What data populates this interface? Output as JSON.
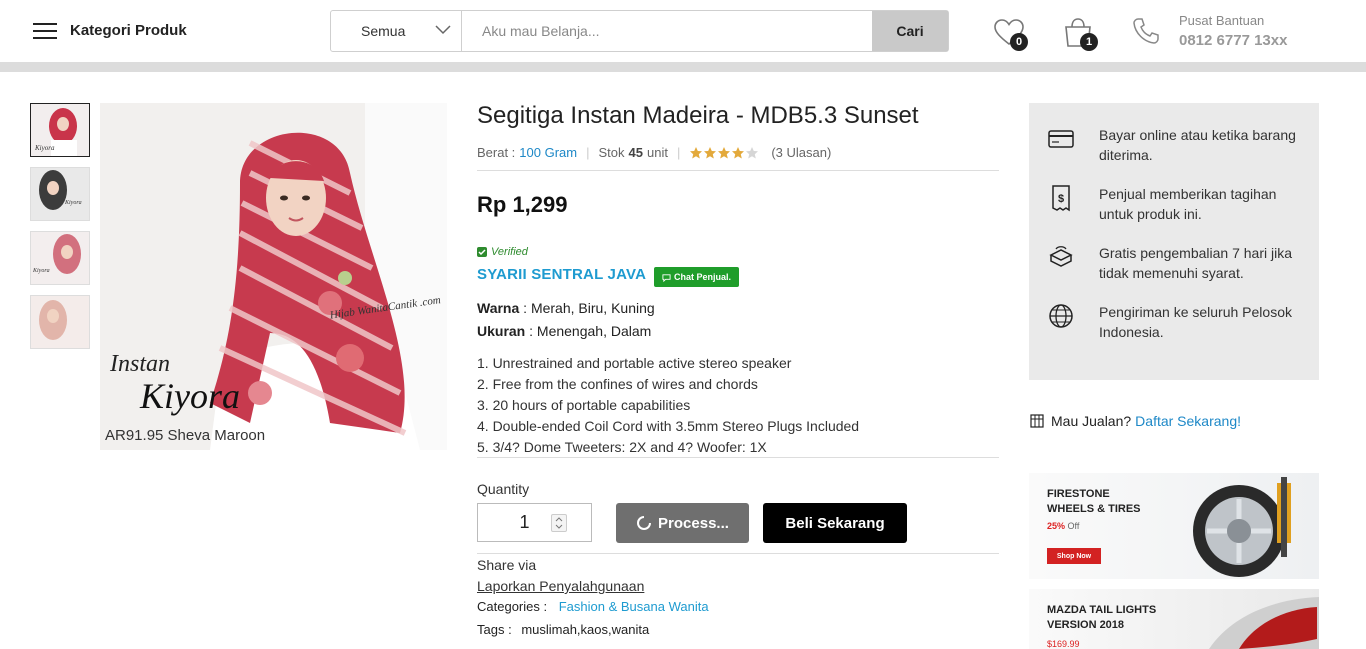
{
  "header": {
    "category_label": "Kategori Produk",
    "search_category": "Semua",
    "search_placeholder": "Aku mau Belanja...",
    "search_button": "Cari",
    "wishlist_count": "0",
    "cart_count": "1",
    "help_label": "Pusat Bantuan",
    "help_phone": "0812 6777 13xx"
  },
  "gallery": {
    "main_caption": "AR91.95 Sheva Maroon",
    "main_script": "Instan",
    "main_script2": "Kiyora",
    "watermark": "Hijab WanitaCantik .com",
    "thumbnail_count": 4
  },
  "product": {
    "title": "Segitiga Instan Madeira - MDB5.3 Sunset",
    "weight_label": "Berat :",
    "weight_value": "100 Gram",
    "stock_label": "Stok",
    "stock_value": "45",
    "stock_unit": "unit",
    "rating": 4,
    "rating_max": 5,
    "reviews": "(3 Ulasan)",
    "price": "Rp 1,299",
    "verified_label": "Verified",
    "seller_name": "SYARII SENTRAL JAVA",
    "chat_button": "Chat Penjual.",
    "color_label": "Warna",
    "color_value": ": Merah, Biru, Kuning",
    "size_label": "Ukuran",
    "size_value": ": Menengah, Dalam",
    "features": [
      "1. Unrestrained and portable active stereo speaker",
      "2. Free from the confines of wires and chords",
      "3. 20 hours of portable capabilities",
      "4. Double-ended Coil Cord with 3.5mm Stereo Plugs Included",
      "5. 3/4? Dome Tweeters: 2X and 4? Woofer: 1X"
    ],
    "quantity_label": "Quantity",
    "quantity_value": "1",
    "process_button": "Process...",
    "buy_button": "Beli Sekarang",
    "share_label": "Share via",
    "report_link": "Laporkan Penyalahgunaan",
    "categories_label": "Categories :",
    "categories_value": "Fashion & Busana Wanita",
    "tags_label": "Tags :",
    "tags_value": "muslimah,kaos,wanita"
  },
  "info": [
    {
      "icon": "credit-card-icon",
      "text": "Bayar online atau ketika barang diterima."
    },
    {
      "icon": "invoice-icon",
      "text": "Penjual memberikan tagihan untuk produk ini."
    },
    {
      "icon": "return-box-icon",
      "text": "Gratis pengembalian 7 hari jika tidak memenuhi syarat."
    },
    {
      "icon": "globe-icon",
      "text": "Pengiriman ke seluruh Pelosok Indonesia."
    }
  ],
  "sell": {
    "prompt": "Mau Jualan?",
    "link": "Daftar Sekarang!"
  },
  "banners": [
    {
      "title_line1": "FIRESTONE",
      "title_line2": "WHEELS & TIRES",
      "discount": "25%",
      "discount_suffix": "Off",
      "button": "Shop Now"
    },
    {
      "title_line1": "MAZDA TAIL LIGHTS",
      "title_line2": "VERSION 2018",
      "price": "$169.99"
    }
  ],
  "colors": {
    "accent_blue": "#1e9bd0",
    "link_blue": "#1e88c7",
    "chat_green": "#1f9d2a",
    "banner_red": "#d32222"
  }
}
